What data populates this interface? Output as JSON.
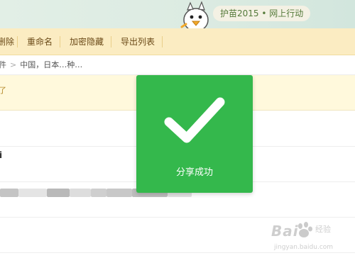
{
  "campaign": {
    "label": "护苗2015 • 网上行动"
  },
  "toolbar": {
    "items": [
      {
        "label": "删除"
      },
      {
        "label": "重命名"
      },
      {
        "label": "加密隐藏"
      },
      {
        "label": "导出列表"
      }
    ]
  },
  "breadcrumb": {
    "parent": "件",
    "separator": ">",
    "current": "中国，日本…种…"
  },
  "notice": {
    "glyph": "了"
  },
  "file_list": {
    "row_fragment": "i"
  },
  "toast": {
    "message": "分享成功",
    "color": "#34b84c"
  },
  "watermark": {
    "brand": "Bai",
    "brand_sub": "经验",
    "url": "jingyan.baidu.com"
  },
  "colors": {
    "toolbar": "#fbecc2",
    "notice": "#fff9dc",
    "banner": "#dcebe2"
  }
}
